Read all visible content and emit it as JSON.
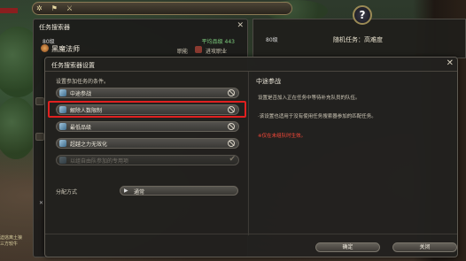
{
  "topbar": {
    "icons": [
      "settings-gear-icon",
      "flag-icon",
      "crossed-swords-icon"
    ]
  },
  "left_edge": {
    "tag": "",
    "lines": [
      "迫逃离土狼",
      "三方较牛"
    ]
  },
  "finder": {
    "title": "任务搜索器",
    "level": "80级",
    "job": "黑魔法师",
    "item_level": "平均品级 443",
    "role_label": "职能",
    "role_value": "进攻职业"
  },
  "duty": {
    "level": "80级",
    "name": "随机任务：高难度",
    "help_symbol": "?"
  },
  "settings": {
    "title": "任务搜索器设置",
    "instruction": "设置参加任务的条件。",
    "options": [
      {
        "label": "中途参战",
        "state": "blocked"
      },
      {
        "label": "解除人数限制",
        "state": "blocked",
        "highlighted": true
      },
      {
        "label": "最低品级",
        "state": "blocked"
      },
      {
        "label": "超越之力无效化",
        "state": "blocked"
      },
      {
        "label": "以组自由队参加的专用项",
        "state": "checked-disabled"
      }
    ],
    "distribution_label": "分配方式",
    "distribution_value": "通常",
    "right": {
      "title": "中途参战",
      "line1": "设置是否加入正在任务中等待补充队员的队伍。",
      "line2": "·该设置也适用于没有使用任务搜索器参加的匹配任务。",
      "warning": "※仅在未组队时生效。"
    },
    "confirm_label": "确定",
    "close_label": "关闭"
  }
}
